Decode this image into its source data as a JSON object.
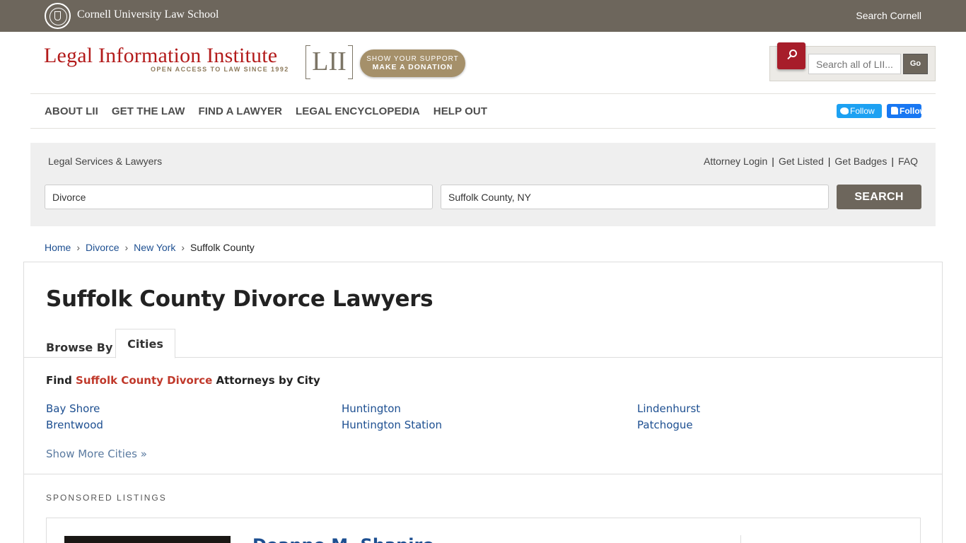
{
  "top_bar": {
    "brand": "Cornell University Law School",
    "search_link": "Search Cornell"
  },
  "header": {
    "logo_text": "Legal Information Institute",
    "tagline": "OPEN ACCESS TO LAW SINCE 1992",
    "lii_mark": "LII",
    "donate_line1": "SHOW YOUR SUPPORT",
    "donate_line2": "MAKE A DONATION",
    "search_placeholder": "Search all of LII...",
    "search_go": "Go"
  },
  "nav": {
    "items": [
      "ABOUT LII",
      "GET THE LAW",
      "FIND A LAWYER",
      "LEGAL ENCYCLOPEDIA",
      "HELP OUT"
    ],
    "twitter_follow": "Follow",
    "facebook_follow": "Follow"
  },
  "legal_services": {
    "title": "Legal Services & Lawyers",
    "links": [
      "Attorney Login",
      "Get Listed",
      "Get Badges",
      "FAQ"
    ],
    "topic_value": "Divorce",
    "location_value": "Suffolk County, NY",
    "search_label": "SEARCH"
  },
  "breadcrumb": [
    "Home",
    "Divorce",
    "New York",
    "Suffolk County"
  ],
  "main": {
    "title": "Suffolk County Divorce Lawyers",
    "browse_by": "Browse By",
    "tab_cities": "Cities",
    "find_prefix": "Find ",
    "find_accent": "Suffolk County Divorce",
    "find_suffix": " Attorneys by City",
    "cities": [
      "Bay Shore",
      "Huntington",
      "Lindenhurst",
      "Brentwood",
      "Huntington Station",
      "Patchogue"
    ],
    "show_more": "Show More Cities »",
    "sponsored_label": "SPONSORED LISTINGS",
    "listing_name": "Deanne M. Shapiro"
  },
  "colors": {
    "cornell_bar": "#6d665c",
    "lii_red": "#b31b1b",
    "link_blue": "#1d4f91",
    "accent_red": "#c0392b"
  }
}
